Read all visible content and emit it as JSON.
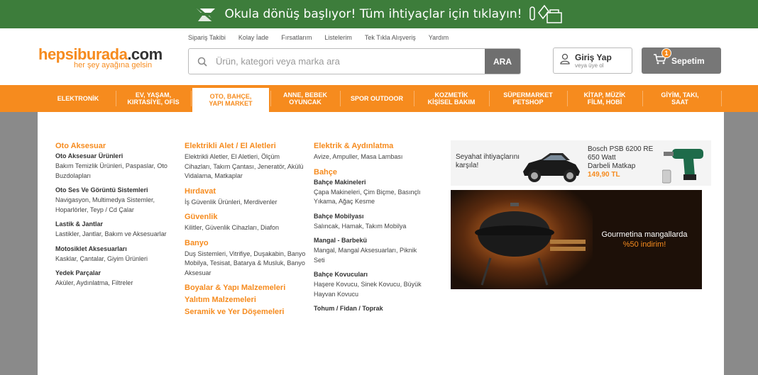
{
  "banner": {
    "text": "Okula dönüş başlıyor! Tüm ihtiyaçlar için tıklayın!"
  },
  "toplinks": [
    "Sipariş Takibi",
    "Kolay İade",
    "Fırsatlarım",
    "Listelerim",
    "Tek Tıkla Alışveriş",
    "Yardım"
  ],
  "logo": {
    "brand_main": "hepsiburada",
    "brand_suffix": ".com",
    "slogan": "her şey ayağına gelsin"
  },
  "search": {
    "placeholder": "Ürün, kategori veya marka ara",
    "button": "ARA"
  },
  "account": {
    "title": "Giriş Yap",
    "subtitle": "veya üye ol"
  },
  "cart": {
    "label": "Sepetim",
    "count": "1"
  },
  "nav": {
    "items": [
      {
        "label": "ELEKTRONİK"
      },
      {
        "label": "EV, YAŞAM, KIRTASİYE, OFİS"
      },
      {
        "label": "OTO, BAHÇE, YAPI MARKET"
      },
      {
        "label": "ANNE, BEBEK OYUNCAK"
      },
      {
        "label": "SPOR OUTDOOR"
      },
      {
        "label": "KOZMETİK KİŞİSEL BAKIM"
      },
      {
        "label": "SÜPERMARKET PETSHOP"
      },
      {
        "label": "KİTAP, MÜZİK FİLM, HOBİ"
      },
      {
        "label": "GİYİM, TAKI, SAAT"
      }
    ],
    "active": "OTO, BAHÇE, YAPI MARKET"
  },
  "menu": {
    "col1": {
      "title": "Oto Aksesuar",
      "groups": [
        {
          "heading": "Oto Aksesuar Ürünleri",
          "items": "Bakım Temizlik Ürünleri, Paspaslar, Oto Buzdolapları"
        },
        {
          "heading": "Oto Ses Ve Görüntü Sistemleri",
          "items": "Navigasyon, Multimedya Sistemler, Hoparlörler, Teyp / Cd Çalar"
        },
        {
          "heading": "Lastik & Jantlar",
          "items": "Lastikler, Jantlar, Bakım ve Aksesuarlar"
        },
        {
          "heading": "Motosiklet Aksesuarları",
          "items": "Kasklar, Çantalar, Giyim Ürünleri"
        },
        {
          "heading": "Yedek Parçalar",
          "items": "Aküler, Aydınlatma, Filtreler"
        }
      ]
    },
    "col2": {
      "sections": [
        {
          "title": "Elektrikli Alet / El Aletleri",
          "items": "Elektrikli Aletler, El Aletleri, Ölçüm Cihazları, Takım Çantası, Jeneratör, Akülü Vidalama, Matkaplar"
        },
        {
          "title": "Hırdavat",
          "items": "İş Güvenlik Ürünleri, Merdivenler"
        },
        {
          "title": "Güvenlik",
          "items": "Kilitler, Güvenlik Cihazları, Diafon"
        },
        {
          "title": "Banyo",
          "items": "Duş Sistemleri, Vitrifiye, Duşakabin, Banyo Mobilya, Tesisat, Batarya & Musluk, Banyo Aksesuar"
        }
      ],
      "extra": [
        "Boyalar & Yapı Malzemeleri",
        "Yalıtım Malzemeleri",
        "Seramik ve Yer Döşemeleri"
      ]
    },
    "col3": {
      "section1": {
        "title": "Elektrik & Aydınlatma",
        "items": "Avize, Ampuller, Masa Lambası"
      },
      "title2": "Bahçe",
      "groups": [
        {
          "heading": "Bahçe Makineleri",
          "items": "Çapa Makineleri, Çim Biçme, Basınçlı Yıkama, Ağaç Kesme"
        },
        {
          "heading": "Bahçe Mobilyası",
          "items": "Salıncak, Hamak, Takım Mobilya"
        },
        {
          "heading": "Mangal - Barbekü",
          "items": "Mangal, Mangal Aksesuarları, Piknik Seti"
        },
        {
          "heading": "Bahçe Kovucuları",
          "items": "Haşere Kovucu, Sinek Kovucu, Büyük Hayvan Kovucu"
        }
      ],
      "last": "Tohum / Fidan / Toprak"
    }
  },
  "ads": {
    "travel": {
      "line1": "Seyahat ihtiyaçlarını",
      "line2": "karşıla!"
    },
    "drill": {
      "line1": "Bosch PSB 6200 RE",
      "line2": "650 Watt",
      "line3": "Darbeli Matkap",
      "price": "149,90 TL"
    },
    "grill": {
      "line1": "Gourmetina mangallarda",
      "line2": "%50 indirim!"
    }
  },
  "colors": {
    "brand_orange": "#f68b1e",
    "banner_green": "#3d7d3b"
  },
  "icons": [
    "pencil-ruler-icon",
    "search-icon",
    "user-icon",
    "cart-icon",
    "school-supplies-icon"
  ]
}
